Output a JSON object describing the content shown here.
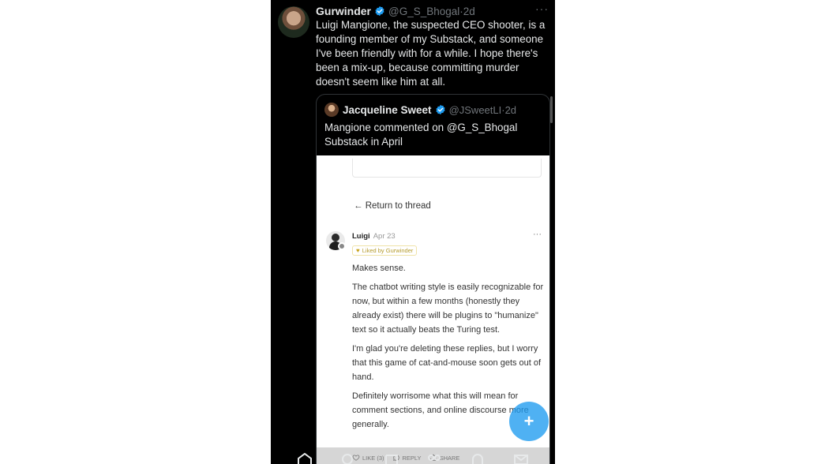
{
  "tweet": {
    "author_name": "Gurwinder",
    "handle": "@G_S_Bhogal",
    "time": "2d",
    "text": "Luigi Mangione, the suspected CEO shooter, is a founding member of my Substack, and someone I've been friendly with for a while. I hope there's been a mix-up, because committing murder doesn't seem like him at all.",
    "more_icon": "···"
  },
  "quote": {
    "author_name": "Jacqueline Sweet",
    "handle": "@JSweetLI",
    "time": "2d",
    "text": "Mangione commented on @G_S_Bhogal Substack in April"
  },
  "substack": {
    "return_link": "← Return to thread",
    "commenter": "Luigi",
    "date": "Apr 23",
    "more_icon": "···",
    "liked_badge": "Liked by Gurwinder",
    "paragraphs": [
      "Makes sense.",
      "The chatbot writing style is easily recognizable for now, but within a few months (honestly they already exist) there will be plugins to \"humanize\" text so it actually beats the Turing test.",
      "I'm glad you're deleting these replies, but I worry that this game of cat-and-mouse soon gets out of hand.",
      "Definitely worrisome what this will mean for comment sections, and online discourse more generally."
    ],
    "actions": {
      "like": "LIKE (3)",
      "reply": "REPLY",
      "share": "SHARE"
    }
  },
  "fab_label": "+",
  "colors": {
    "background": "#000000",
    "text": "#e7e9ea",
    "muted": "#71767b",
    "verified": "#1d9bf0",
    "accent": "#1d9bf0"
  },
  "icons": [
    "verified-badge-icon",
    "home-icon",
    "search-icon",
    "grok-icon",
    "communities-icon",
    "notifications-icon",
    "messages-icon",
    "heart-icon",
    "reply-icon",
    "share-icon"
  ]
}
